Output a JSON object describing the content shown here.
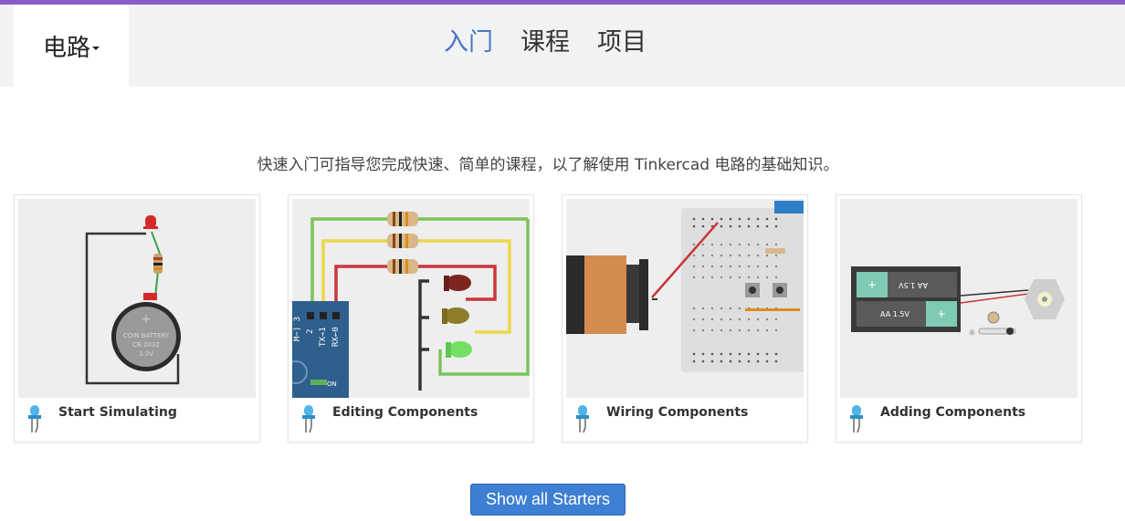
{
  "header": {
    "dropdown_label": "电路",
    "tabs": [
      {
        "label": "入门",
        "active": true
      },
      {
        "label": "课程",
        "active": false
      },
      {
        "label": "项目",
        "active": false
      }
    ]
  },
  "intro_text": "快速入门可指导您完成快速、简单的课程，以了解使用 Tinkercad 电路的基础知识。",
  "cards": [
    {
      "title": "Start Simulating",
      "icon": "blue-led-icon"
    },
    {
      "title": "Editing Components",
      "icon": "blue-led-icon"
    },
    {
      "title": "Wiring Components",
      "icon": "blue-led-icon"
    },
    {
      "title": "Adding Components",
      "icon": "blue-led-icon"
    }
  ],
  "thumbs": {
    "coin_battery": {
      "line1": "COIN BATTERY",
      "line2": "CR 2032",
      "line3": "3.0V"
    },
    "arduino_pins": [
      "M~) 3",
      "2",
      "TX→1",
      "RX←0"
    ],
    "arduino_on": "ON",
    "battery_labels": [
      "AA 1.5V",
      "AA 1.5V"
    ]
  },
  "show_all_button": "Show all Starters",
  "colors": {
    "accent_bar": "#8a5bc7",
    "active_tab": "#4a74c9",
    "button": "#3d7fd3"
  }
}
